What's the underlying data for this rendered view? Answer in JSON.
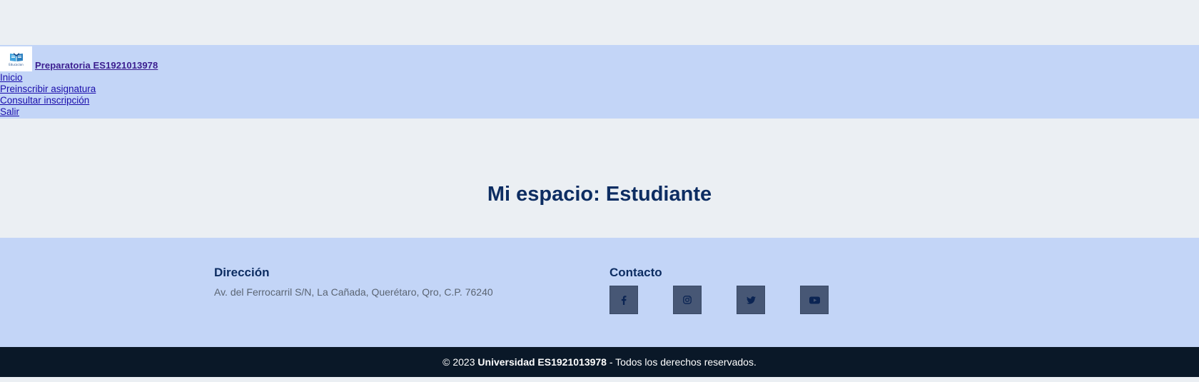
{
  "header": {
    "logo_text": "Educacion",
    "brand_name": "Preparatoria ES1921013978",
    "nav": [
      {
        "label": "Inicio"
      },
      {
        "label": "Preinscribir asignatura"
      },
      {
        "label": "Consultar inscripción"
      },
      {
        "label": "Salir"
      }
    ]
  },
  "main": {
    "title": "Mi espacio: Estudiante"
  },
  "footer": {
    "address_heading": "Dirección",
    "address": "Av. del Ferrocarril S/N, La Cañada, Querétaro, Qro, C.P. 76240",
    "contact_heading": "Contacto",
    "social": [
      {
        "icon": "facebook-icon"
      },
      {
        "icon": "instagram-icon"
      },
      {
        "icon": "twitter-icon"
      },
      {
        "icon": "youtube-icon"
      }
    ],
    "copyright_prefix": "© 2023 ",
    "copyright_org": "Universidad ES1921013978",
    "copyright_suffix": " - Todos los derechos reservados."
  },
  "colors": {
    "page_bg": "#ebeff3",
    "nav_bg": "#c3d5f7",
    "title": "#0d2d62",
    "social_btn": "#475775",
    "social_icon": "#0b2453",
    "copyright_bg": "#0a1828"
  }
}
